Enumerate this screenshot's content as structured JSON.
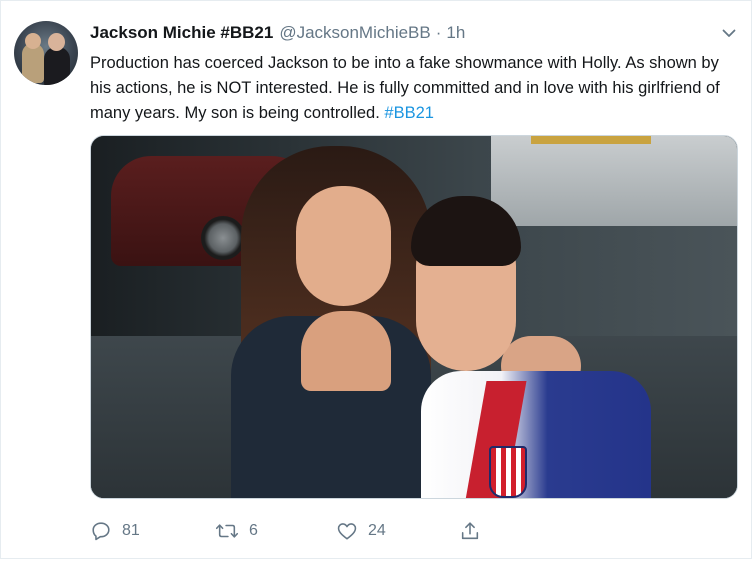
{
  "tweet": {
    "author_name": "Jackson Michie #BB21",
    "handle": "@JacksonMichieBB",
    "separator": "·",
    "time": "1h",
    "text_main": "Production has coerced Jackson to be into a fake showmance with Holly. As shown by his actions, he is NOT interested. He is fully committed and in love with his girlfriend of many years. My son is being controlled.",
    "hashtag": "#BB21"
  },
  "actions": {
    "reply_count": "81",
    "retweet_count": "6",
    "like_count": "24"
  },
  "icons": {
    "reply": "reply-icon",
    "retweet": "retweet-icon",
    "like": "heart-icon",
    "share": "share-icon",
    "caret": "chevron-down-icon"
  },
  "colors": {
    "text": "#14171a",
    "secondary": "#657786",
    "link": "#1b95e0"
  }
}
